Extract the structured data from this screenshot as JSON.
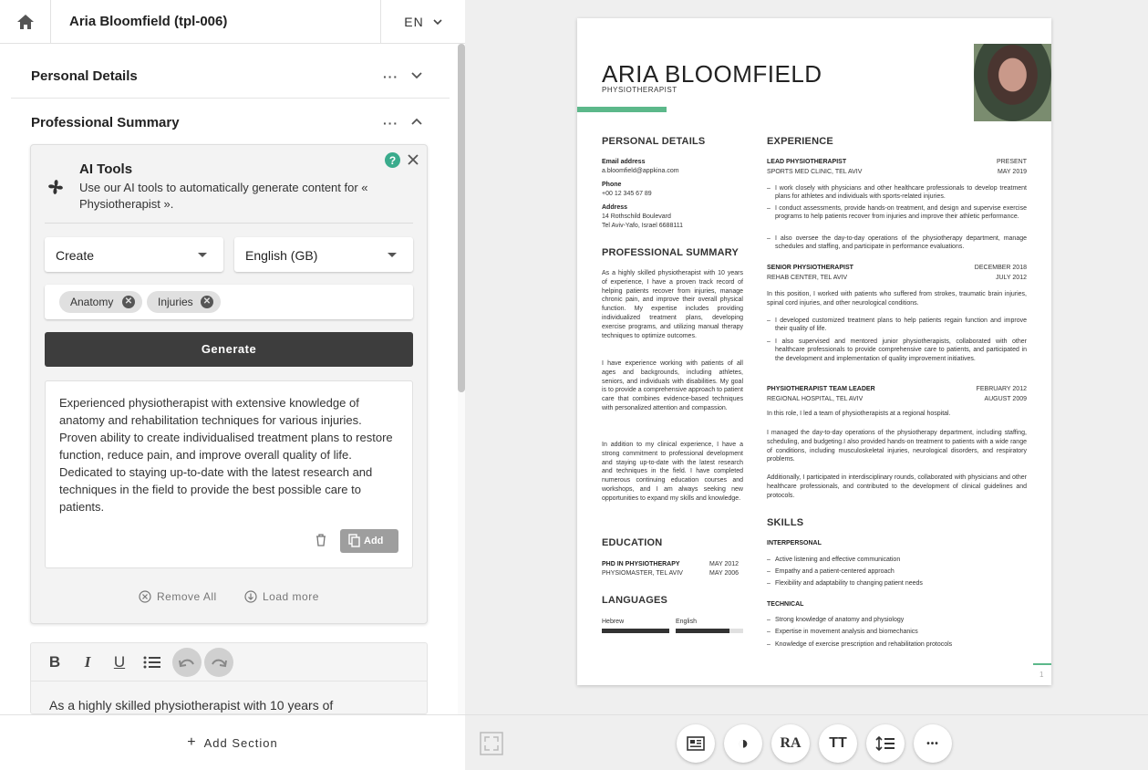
{
  "header": {
    "title": "Aria Bloomfield (tpl-006)",
    "lang": "EN"
  },
  "sections": {
    "personal": "Personal Details",
    "summary": "Professional Summary",
    "dots": "···"
  },
  "ai": {
    "title": "AI Tools",
    "desc": "Use our AI tools to automatically generate content for « Physiotherapist ».",
    "help": "?",
    "mode": "Create",
    "language": "English (GB)",
    "tags": [
      "Anatomy",
      "Injuries"
    ],
    "generate": "Generate",
    "result": "Experienced physiotherapist with extensive knowledge of anatomy and rehabilitation techniques for various injuries. Proven ability to create individualised treatment plans to restore function, reduce pain, and improve overall quality of life. Dedicated to staying up-to-date with the latest research and techniques in the field to provide the best possible care to patients.",
    "add": "Add",
    "remove_all": "Remove All",
    "load_more": "Load more"
  },
  "editor": {
    "bold": "B",
    "italic": "I",
    "underline": "U",
    "text": "As a highly skilled physiotherapist with 10 years of"
  },
  "add_section": "Add Section",
  "bottom_tools": [
    "layout-icon",
    "contrast-icon",
    "font-icon",
    "text-size-icon",
    "line-spacing-icon",
    "more-icon"
  ],
  "bottom_glyphs": {
    "contrast": "◑",
    "font": "RA",
    "size": "TT",
    "more": "•••"
  },
  "resume": {
    "name": "ARIA BLOOMFIELD",
    "role": "PHYSIOTHERAPIST",
    "personal_title": "PERSONAL DETAILS",
    "email_label": "Email address",
    "email": "a.bloomfield@appkina.com",
    "phone_label": "Phone",
    "phone": "+00 12 345 67 89",
    "address_label": "Address",
    "address1": "14 Rothschild Boulevard",
    "address2": "Tel Aviv-Yafo, Israel 6688111",
    "summary_title": "PROFESSIONAL SUMMARY",
    "summary_p1": "As a highly skilled physiotherapist with 10 years of experience, I have a proven track record of helping patients recover from injuries, manage chronic pain, and improve their overall physical function. My expertise includes providing individualized treatment plans, developing exercise programs, and utilizing manual therapy techniques to optimize outcomes.",
    "summary_p2": "I have experience working with patients of all ages and backgrounds, including athletes, seniors, and individuals with disabilities. My goal is to provide a comprehensive approach to patient care that combines evidence-based techniques with personalized attention and compassion.",
    "summary_p3": "In addition to my clinical experience, I have a strong commitment to professional development and staying up-to-date with the latest research and techniques in the field. I have completed numerous continuing education courses and workshops, and I am always seeking new opportunities to expand my skills and knowledge.",
    "education_title": "EDUCATION",
    "edu_degree": "PHD IN PHYSIOTHERAPY",
    "edu_end": "MAY 2012",
    "edu_school": "PHYSIOMASTER, TEL AVIV",
    "edu_start": "MAY 2006",
    "languages_title": "LANGUAGES",
    "languages": [
      {
        "name": "Hebrew",
        "level": 1.0
      },
      {
        "name": "English",
        "level": 0.8
      }
    ],
    "experience_title": "EXPERIENCE",
    "job1_title": "LEAD PHYSIOTHERAPIST",
    "job1_end": "PRESENT",
    "job1_company": "SPORTS MED CLINIC, TEL AVIV",
    "job1_start": "MAY 2019",
    "job1_b1": "I work closely with physicians and other healthcare professionals to develop treatment plans for athletes and individuals with sports-related injuries.",
    "job1_b2": "I conduct assessments, provide hands-on treatment, and design and supervise exercise programs to help patients recover from injuries and improve their athletic performance.",
    "job1_b3": "I also oversee the day-to-day operations of the physiotherapy department, manage schedules and staffing, and participate in performance evaluations.",
    "job2_title": "SENIOR PHYSIOTHERAPIST",
    "job2_end": "DECEMBER 2018",
    "job2_company": "REHAB CENTER, TEL AVIV",
    "job2_start": "JULY 2012",
    "job2_p": "In this position, I worked with patients who suffered from strokes, traumatic brain injuries, spinal cord injuries, and other neurological conditions.",
    "job2_b1": "I developed customized treatment plans to help patients regain function and improve their quality of life.",
    "job2_b2": "I also supervised and mentored junior physiotherapists, collaborated with other healthcare professionals to provide comprehensive care to patients, and participated in the development and implementation of quality improvement initiatives.",
    "job3_title": "PHYSIOTHERAPIST TEAM LEADER",
    "job3_end": "FEBRUARY 2012",
    "job3_company": "REGIONAL HOSPITAL, TEL AVIV",
    "job3_start": "AUGUST 2009",
    "job3_p1": "In this role, I led a team of physiotherapists at a regional hospital.",
    "job3_p2": "I managed the day-to-day operations of the physiotherapy department, including staffing, scheduling, and budgeting.I also provided hands-on treatment to patients with a wide range of conditions, including musculoskeletal injuries, neurological disorders, and respiratory problems.",
    "job3_p3": "Additionally, I participated in interdisciplinary rounds, collaborated with physicians and other healthcare professionals, and contributed to the development of clinical guidelines and protocols.",
    "skills_title": "SKILLS",
    "interpersonal": "INTERPERSONAL",
    "skill_i1": "Active listening and effective communication",
    "skill_i2": "Empathy and a patient-centered approach",
    "skill_i3": "Flexibility and adaptability to changing patient needs",
    "technical": "TECHNICAL",
    "skill_t1": "Strong knowledge of anatomy and physiology",
    "skill_t2": "Expertise in movement analysis and biomechanics",
    "skill_t3": "Knowledge of exercise prescription and rehabilitation protocols",
    "page": "1"
  },
  "colors": {
    "accent": "#5cb88a",
    "help": "#3aab8c",
    "dark": "#3d3d3d"
  }
}
